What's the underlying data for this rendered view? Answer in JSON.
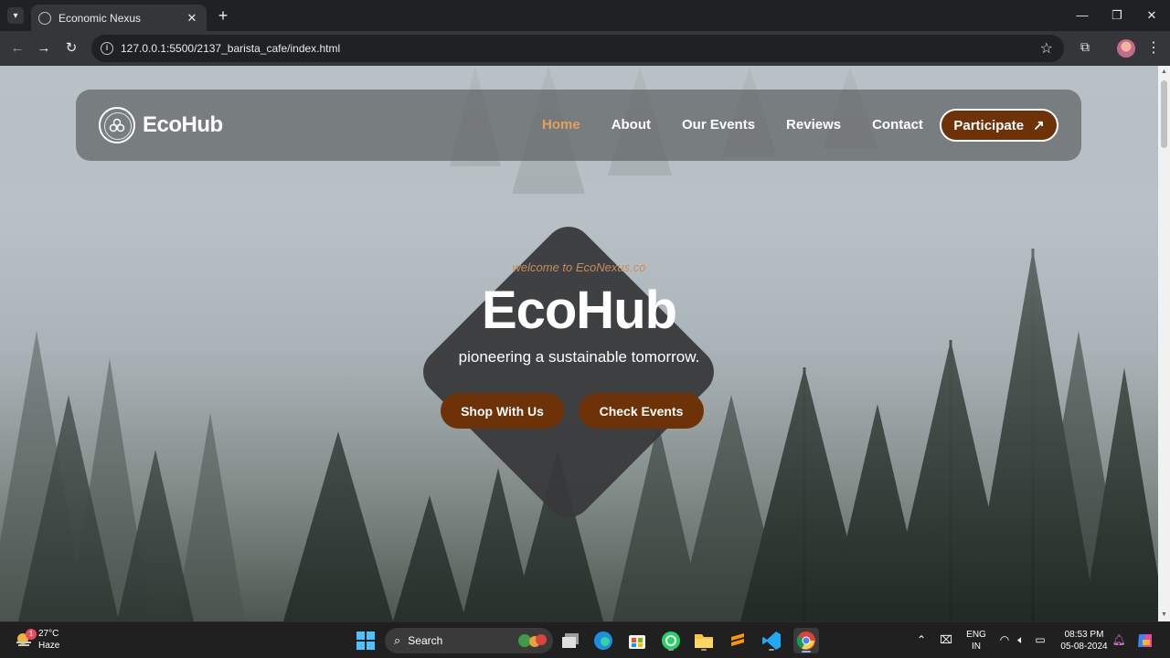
{
  "browser": {
    "tab_title": "Economic Nexus",
    "url": "127.0.0.1:5500/2137_barista_cafe/index.html",
    "icons": [
      "tab-search-icon",
      "globe-icon",
      "close-icon",
      "plus-icon",
      "minimize-icon",
      "maximize-icon",
      "back-icon",
      "forward-icon",
      "reload-icon",
      "info-icon",
      "star-icon",
      "extensions-icon",
      "profile-avatar",
      "kebab-menu-icon"
    ]
  },
  "site": {
    "logo_text": "EcoHub",
    "nav": [
      {
        "label": "Home",
        "active": true
      },
      {
        "label": "About",
        "active": false
      },
      {
        "label": "Our Events",
        "active": false
      },
      {
        "label": "Reviews",
        "active": false
      },
      {
        "label": "Contact",
        "active": false
      }
    ],
    "cta_label": "Participate",
    "hero": {
      "welcome": "welcome to EcoNexus.co",
      "title": "EcoHub",
      "subtitle": "pioneering a sustainable tomorrow.",
      "buttons": [
        "Shop With Us",
        "Check Events"
      ]
    },
    "colors": {
      "accent_brown": "#6e3208",
      "active_link": "#e4a05b",
      "navbar_bg": "#5f6264",
      "diamond_bg": "#37383a"
    }
  },
  "taskbar": {
    "weather_temp": "27°C",
    "weather_desc": "Haze",
    "weather_badge": "1",
    "search_label": "Search",
    "lang_line1": "ENG",
    "lang_line2": "IN",
    "time": "08:53 PM",
    "date": "05-08-2024",
    "icons": [
      "windows-start-icon",
      "search-icon",
      "file-explorer-window-icon",
      "edge-icon",
      "store-icon",
      "whatsapp-icon",
      "folder-icon",
      "sublime-icon",
      "vscode-icon",
      "chrome-icon",
      "chevron-up-icon",
      "meet-icon",
      "wifi-icon",
      "volume-icon",
      "battery-icon",
      "bell-icon",
      "copilot-icon"
    ]
  }
}
